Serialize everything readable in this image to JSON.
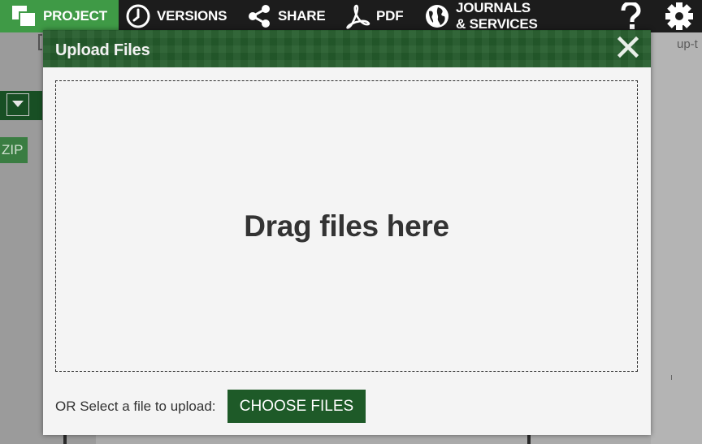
{
  "nav": {
    "project": "PROJECT",
    "versions": "VERSIONS",
    "share": "SHARE",
    "pdf": "PDF",
    "journals_line1": "JOURNALS",
    "journals_line2": "& SERVICES",
    "help_icon": "question-mark-icon",
    "settings_icon": "gear-icon"
  },
  "background": {
    "zip_label": "ZIP",
    "right_text": "up-t"
  },
  "modal": {
    "title": "Upload Files",
    "close_icon": "close-icon",
    "drop_text": "Drag files here",
    "select_label": "OR Select a file to upload:",
    "choose_button": "CHOOSE FILES"
  },
  "colors": {
    "active_tab": "#3f9a46",
    "header_green": "#245b2b",
    "button_green": "#1e5a28",
    "topbar": "#1c1c1c"
  }
}
